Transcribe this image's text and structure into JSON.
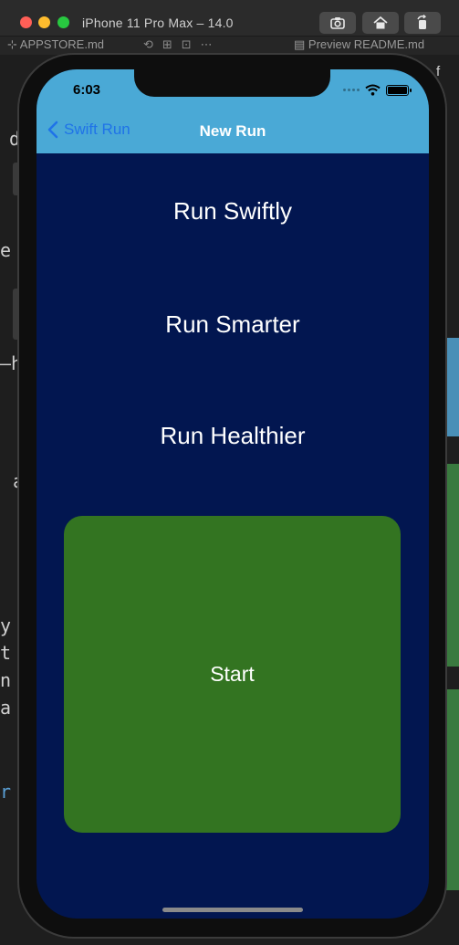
{
  "simulator": {
    "title": "iPhone 11 Pro Max – 14.0",
    "buttons": {
      "screenshot_icon": "camera-icon",
      "home_icon": "home-icon",
      "rotate_icon": "rotate-icon"
    }
  },
  "editor": {
    "left_tab": "APPSTORE.md",
    "right_tab": "Preview README.md"
  },
  "status_bar": {
    "time": "6:03",
    "wifi_icon": "wifi-icon",
    "battery_icon": "battery-icon"
  },
  "nav": {
    "back_label": "Swift Run",
    "title": "New Run",
    "back_icon": "chevron-left-icon"
  },
  "slogans": [
    "Run Swiftly",
    "Run Smarter",
    "Run Healthier"
  ],
  "start_label": "Start",
  "colors": {
    "nav_bar": "#4aa9d6",
    "screen_background": "#021650",
    "start_button": "#337421",
    "back_link": "#1f73e8"
  }
}
